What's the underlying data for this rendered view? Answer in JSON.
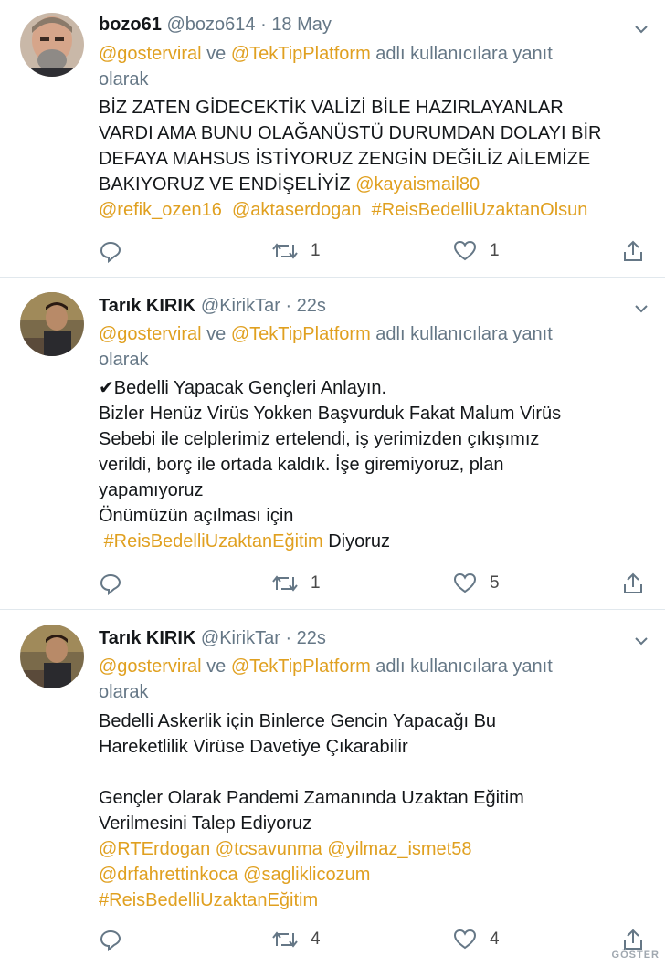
{
  "tweets": [
    {
      "name": "bozo61",
      "handle": "@bozo614",
      "dot": "·",
      "time": "18 May",
      "reply_mention1": "@gosterviral",
      "reply_ve": " ve ",
      "reply_mention2": "@TekTipPlatform",
      "reply_rest": " adlı kullanıcılara yanıt",
      "reply_line2": "olarak",
      "lines": [
        "BİZ ZATEN GİDECEKTİK VALİZİ BİLE HAZIRLAYANLAR",
        "VARDI AMA BUNU OLAĞANÜSTÜ DURUMDAN DOLAYI BİR",
        "DEFAYA MAHSUS İSTİYORUZ ZENGİN DEĞİLİZ AİLEMİZE",
        "BAKIYORUZ VE ENDİŞELİYİZ "
      ],
      "line4_tag": "@kayaismail80",
      "line5_tags": [
        "@refik_ozen16",
        "@aktaserdogan",
        "#ReisBedelliUzaktanOlsun"
      ],
      "retweets": "1",
      "likes": "1"
    },
    {
      "name": "Tarık KIRIK",
      "handle": "@KirikTar",
      "dot": "·",
      "time": "22s",
      "reply_mention1": "@gosterviral",
      "reply_ve": " ve ",
      "reply_mention2": "@TekTipPlatform",
      "reply_rest": " adlı kullanıcılara yanıt",
      "reply_line2": "olarak",
      "lines": [
        "✔Bedelli Yapacak Gençleri Anlayın.",
        "Bizler Henüz Virüs Yokken Başvurduk Fakat Malum Virüs",
        "Sebebi ile celplerimiz ertelendi, iş yerimizden çıkışımız",
        "verildi, borç ile ortada kaldık. İşe giremiyoruz, plan",
        "yapamıyoruz",
        "Önümüzün açılması için"
      ],
      "last_tag": "#ReisBedelliUzaktanEğitim",
      "last_rest": " Diyoruz",
      "retweets": "1",
      "likes": "5"
    },
    {
      "name": "Tarık KIRIK",
      "handle": "@KirikTar",
      "dot": "·",
      "time": "22s",
      "reply_mention1": "@gosterviral",
      "reply_ve": " ve ",
      "reply_mention2": "@TekTipPlatform",
      "reply_rest": " adlı kullanıcılara yanıt",
      "reply_line2": "olarak",
      "lines": [
        "Bedelli Askerlik için Binlerce Gencin Yapacağı Bu",
        "Hareketlilik Virüse Davetiye Çıkarabilir",
        "Gençler Olarak Pandemi Zamanında Uzaktan Eğitim",
        "Verilmesini Talep Ediyoruz"
      ],
      "tag_line1": [
        "@RTErdogan",
        "@tcsavunma",
        "@yilmaz_ismet58"
      ],
      "tag_line2": [
        "@drfahrettinkoca",
        "@sagliklicozum"
      ],
      "tag_line3": "#ReisBedelliUzaktanEğitim",
      "retweets": "4",
      "likes": "4"
    }
  ],
  "watermark": "GÖSTER",
  "icons": [
    "caret-down-icon",
    "reply-icon",
    "retweet-icon",
    "like-icon",
    "share-icon"
  ],
  "colors": {
    "mention": "#e0a020",
    "secondary": "#657786",
    "divider": "#e1e8ed"
  }
}
